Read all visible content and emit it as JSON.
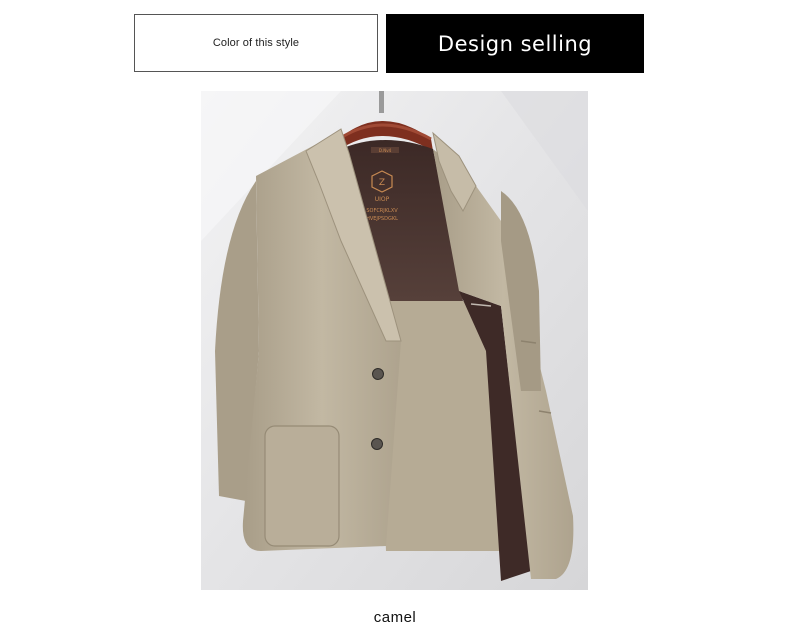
{
  "header": {
    "color_tab_label": "Color of this style",
    "design_tab_label": "Design selling"
  },
  "product": {
    "label_brand": "UIOP",
    "label_line1": "SOFCRJKLXV",
    "label_line2": "HVEJPSDGKL",
    "hanger_size_tag": "D.Nv4",
    "color_name": "camel"
  },
  "colors": {
    "coat": "#bfb4a0",
    "lining": "#4b3531",
    "hanger": "#7e2f1f",
    "label_text": "#c88a52"
  }
}
